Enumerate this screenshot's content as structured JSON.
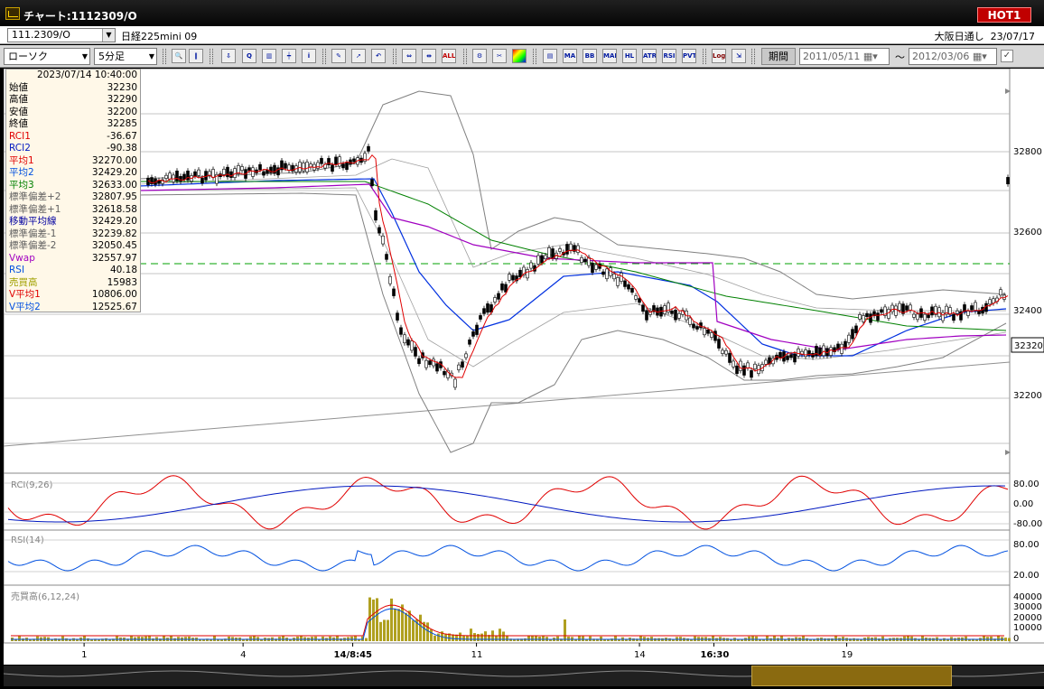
{
  "window": {
    "title": "チャート:1112309/O",
    "hot_label": "HOT1"
  },
  "symbol": {
    "code": "111.2309/O",
    "name": "日経225mini 09",
    "exchange": "大阪日通し",
    "date": "23/07/17"
  },
  "toolbar": {
    "chart_type": "ローソク",
    "interval": "5分足",
    "buttons": [
      "MA",
      "BB",
      "MAE",
      "HL",
      "ATR",
      "RSI",
      "PVT",
      "Log"
    ],
    "period_label": "期間",
    "date_from": "2011/05/11",
    "date_to": "2012/03/06",
    "tilde": "〜"
  },
  "info_panel": {
    "datetime": "2023/07/14  10:40:00",
    "rows": [
      {
        "label": "始値",
        "value": "32230",
        "color": "#000000"
      },
      {
        "label": "高値",
        "value": "32290",
        "color": "#000000"
      },
      {
        "label": "安値",
        "value": "32200",
        "color": "#000000"
      },
      {
        "label": "終値",
        "value": "32285",
        "color": "#000000"
      },
      {
        "label": "RCI1",
        "value": "-36.67",
        "color": "#e00000"
      },
      {
        "label": "RCI2",
        "value": "-90.38",
        "color": "#0018c0"
      },
      {
        "label": "平均1",
        "value": "32270.00",
        "color": "#e00000"
      },
      {
        "label": "平均2",
        "value": "32429.20",
        "color": "#0050e0"
      },
      {
        "label": "平均3",
        "value": "32633.00",
        "color": "#008000"
      },
      {
        "label": "標準偏差+2",
        "value": "32807.95",
        "color": "#606060"
      },
      {
        "label": "標準偏差+1",
        "value": "32618.58",
        "color": "#606060"
      },
      {
        "label": "移動平均線",
        "value": "32429.20",
        "color": "#0000a0"
      },
      {
        "label": "標準偏差-1",
        "value": "32239.82",
        "color": "#606060"
      },
      {
        "label": "標準偏差-2",
        "value": "32050.45",
        "color": "#606060"
      },
      {
        "label": "Vwap",
        "value": "32557.97",
        "color": "#a000c0"
      },
      {
        "label": "RSI",
        "value": "40.18",
        "color": "#0050e0"
      },
      {
        "label": "売買高",
        "value": "15983",
        "color": "#a0a000"
      },
      {
        "label": "V平均1",
        "value": "10806.00",
        "color": "#e00000"
      },
      {
        "label": "V平均2",
        "value": "12525.67",
        "color": "#0050e0"
      }
    ]
  },
  "price_panel": {
    "axis_labels": [
      "32800",
      "32600",
      "32400",
      "32200"
    ],
    "current_price": "32320",
    "colors": {
      "ma1": "#e00000",
      "ma2": "#0030e0",
      "ma3": "#008000",
      "vwap": "#a000c0",
      "band": "#808080",
      "dashed": "#00a000"
    }
  },
  "rci_panel": {
    "title": "RCI(9,26)",
    "axis_labels": [
      "80.00",
      "0.00",
      "-80.00"
    ]
  },
  "rsi_panel": {
    "title": "RSI(14)",
    "axis_labels": [
      "80.00",
      "20.00"
    ]
  },
  "volume_panel": {
    "title": "売買高(6,12,24)",
    "axis_labels": [
      "40000",
      "30000",
      "20000",
      "10000",
      "0"
    ]
  },
  "x_axis": {
    "labels": [
      {
        "text": "1",
        "bold": false,
        "pos": 0.08
      },
      {
        "text": "4",
        "bold": false,
        "pos": 0.238
      },
      {
        "text": "14/8:45",
        "bold": true,
        "pos": 0.347
      },
      {
        "text": "11",
        "bold": false,
        "pos": 0.47
      },
      {
        "text": "14",
        "bold": false,
        "pos": 0.632
      },
      {
        "text": "16:30",
        "bold": true,
        "pos": 0.706
      },
      {
        "text": "19",
        "bold": false,
        "pos": 0.838
      }
    ]
  }
}
